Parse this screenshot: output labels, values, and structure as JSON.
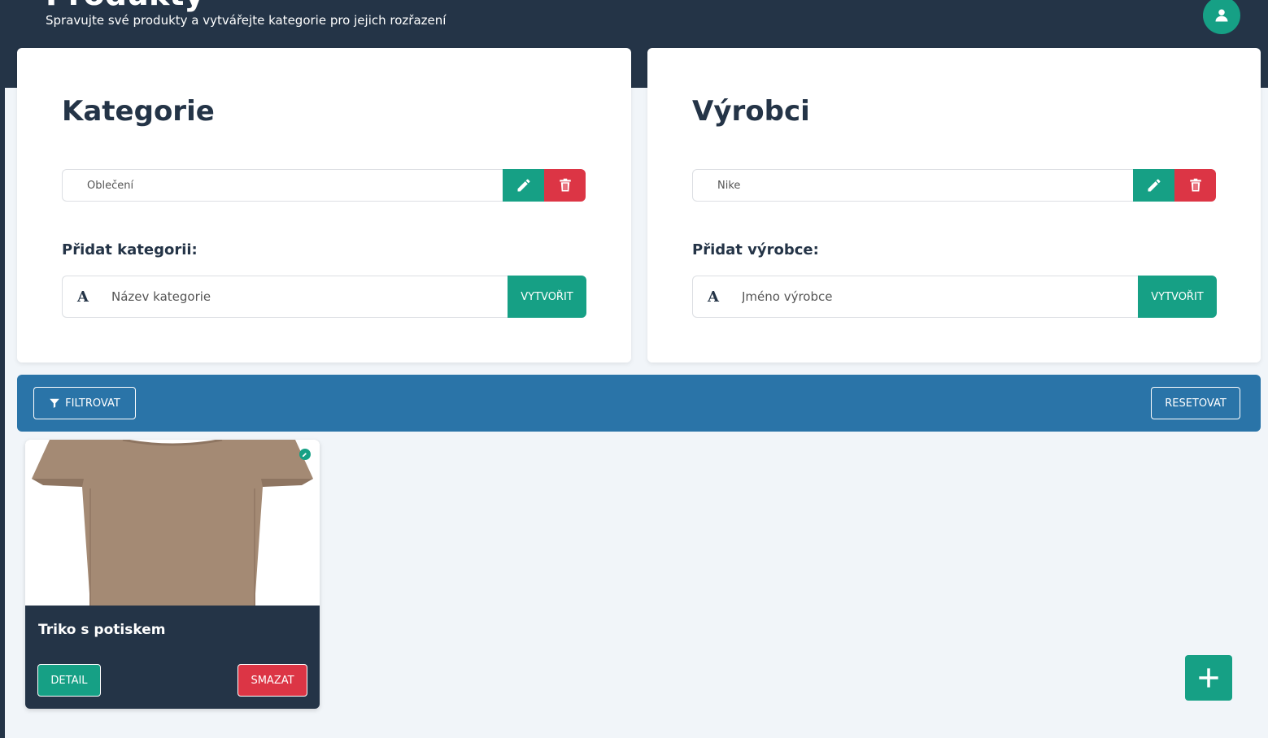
{
  "header": {
    "title": "Produkty",
    "subtitle": "Spravujte své produkty a vytvářejte kategorie pro jejich rozřazení"
  },
  "categories_panel": {
    "title": "Kategorie",
    "item_value": "Oblečení",
    "add_label": "Přidat kategorii:",
    "add_placeholder": "Název kategorie",
    "create_button": "VYTVOŘIT",
    "icons": [
      "pencil-icon",
      "trash-icon",
      "font-icon"
    ]
  },
  "manufacturers_panel": {
    "title": "Výrobci",
    "item_value": "Nike",
    "add_label": "Přidat výrobce:",
    "add_placeholder": "Jméno výrobce",
    "create_button": "VYTVOŘIT",
    "icons": [
      "pencil-icon",
      "trash-icon",
      "font-icon"
    ]
  },
  "filter_bar": {
    "filter_button": "FILTROVAT",
    "reset_button": "RESETOVAT",
    "filter_icon": "funnel-icon"
  },
  "products": [
    {
      "name": "Triko s potiskem",
      "detail_button": "DETAIL",
      "delete_button": "SMAZAT",
      "image": "tshirt-image",
      "status": "active"
    }
  ],
  "colors": {
    "header_bg": "#243447",
    "accent_green": "#16a085",
    "danger_red": "#dc3545",
    "filter_blue": "#2a74a8",
    "page_bg": "#f1f5f9"
  },
  "fab": {
    "icon": "plus-icon"
  },
  "avatar": {
    "icon": "user-icon"
  }
}
